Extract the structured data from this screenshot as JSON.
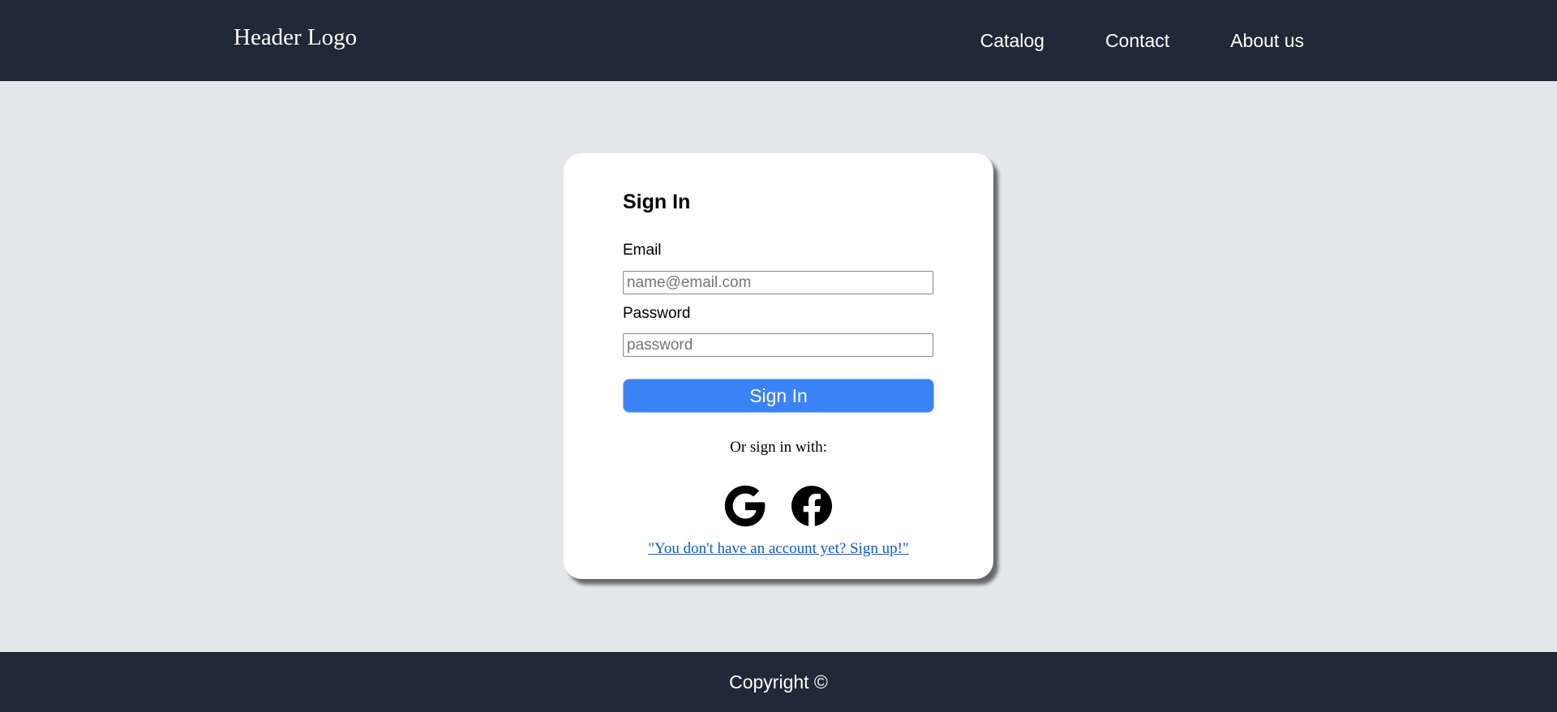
{
  "header": {
    "logo": "Header Logo",
    "nav": [
      "Catalog",
      "Contact",
      "About us"
    ]
  },
  "signin": {
    "title": "Sign In",
    "email_label": "Email",
    "email_placeholder": "name@email.com",
    "password_label": "Password",
    "password_placeholder": "password",
    "button_label": "Sign In",
    "or_text": "Or sign in with:",
    "social": [
      "google-icon",
      "facebook-icon"
    ],
    "signup_text": "\"You don't have an account yet? Sign up!\""
  },
  "footer": {
    "copyright": "Copyright ©"
  },
  "colors": {
    "header_bg": "#1f2937",
    "page_bg": "#e5e7eb",
    "primary": "#3b82f6",
    "link": "#0b5bd3"
  }
}
